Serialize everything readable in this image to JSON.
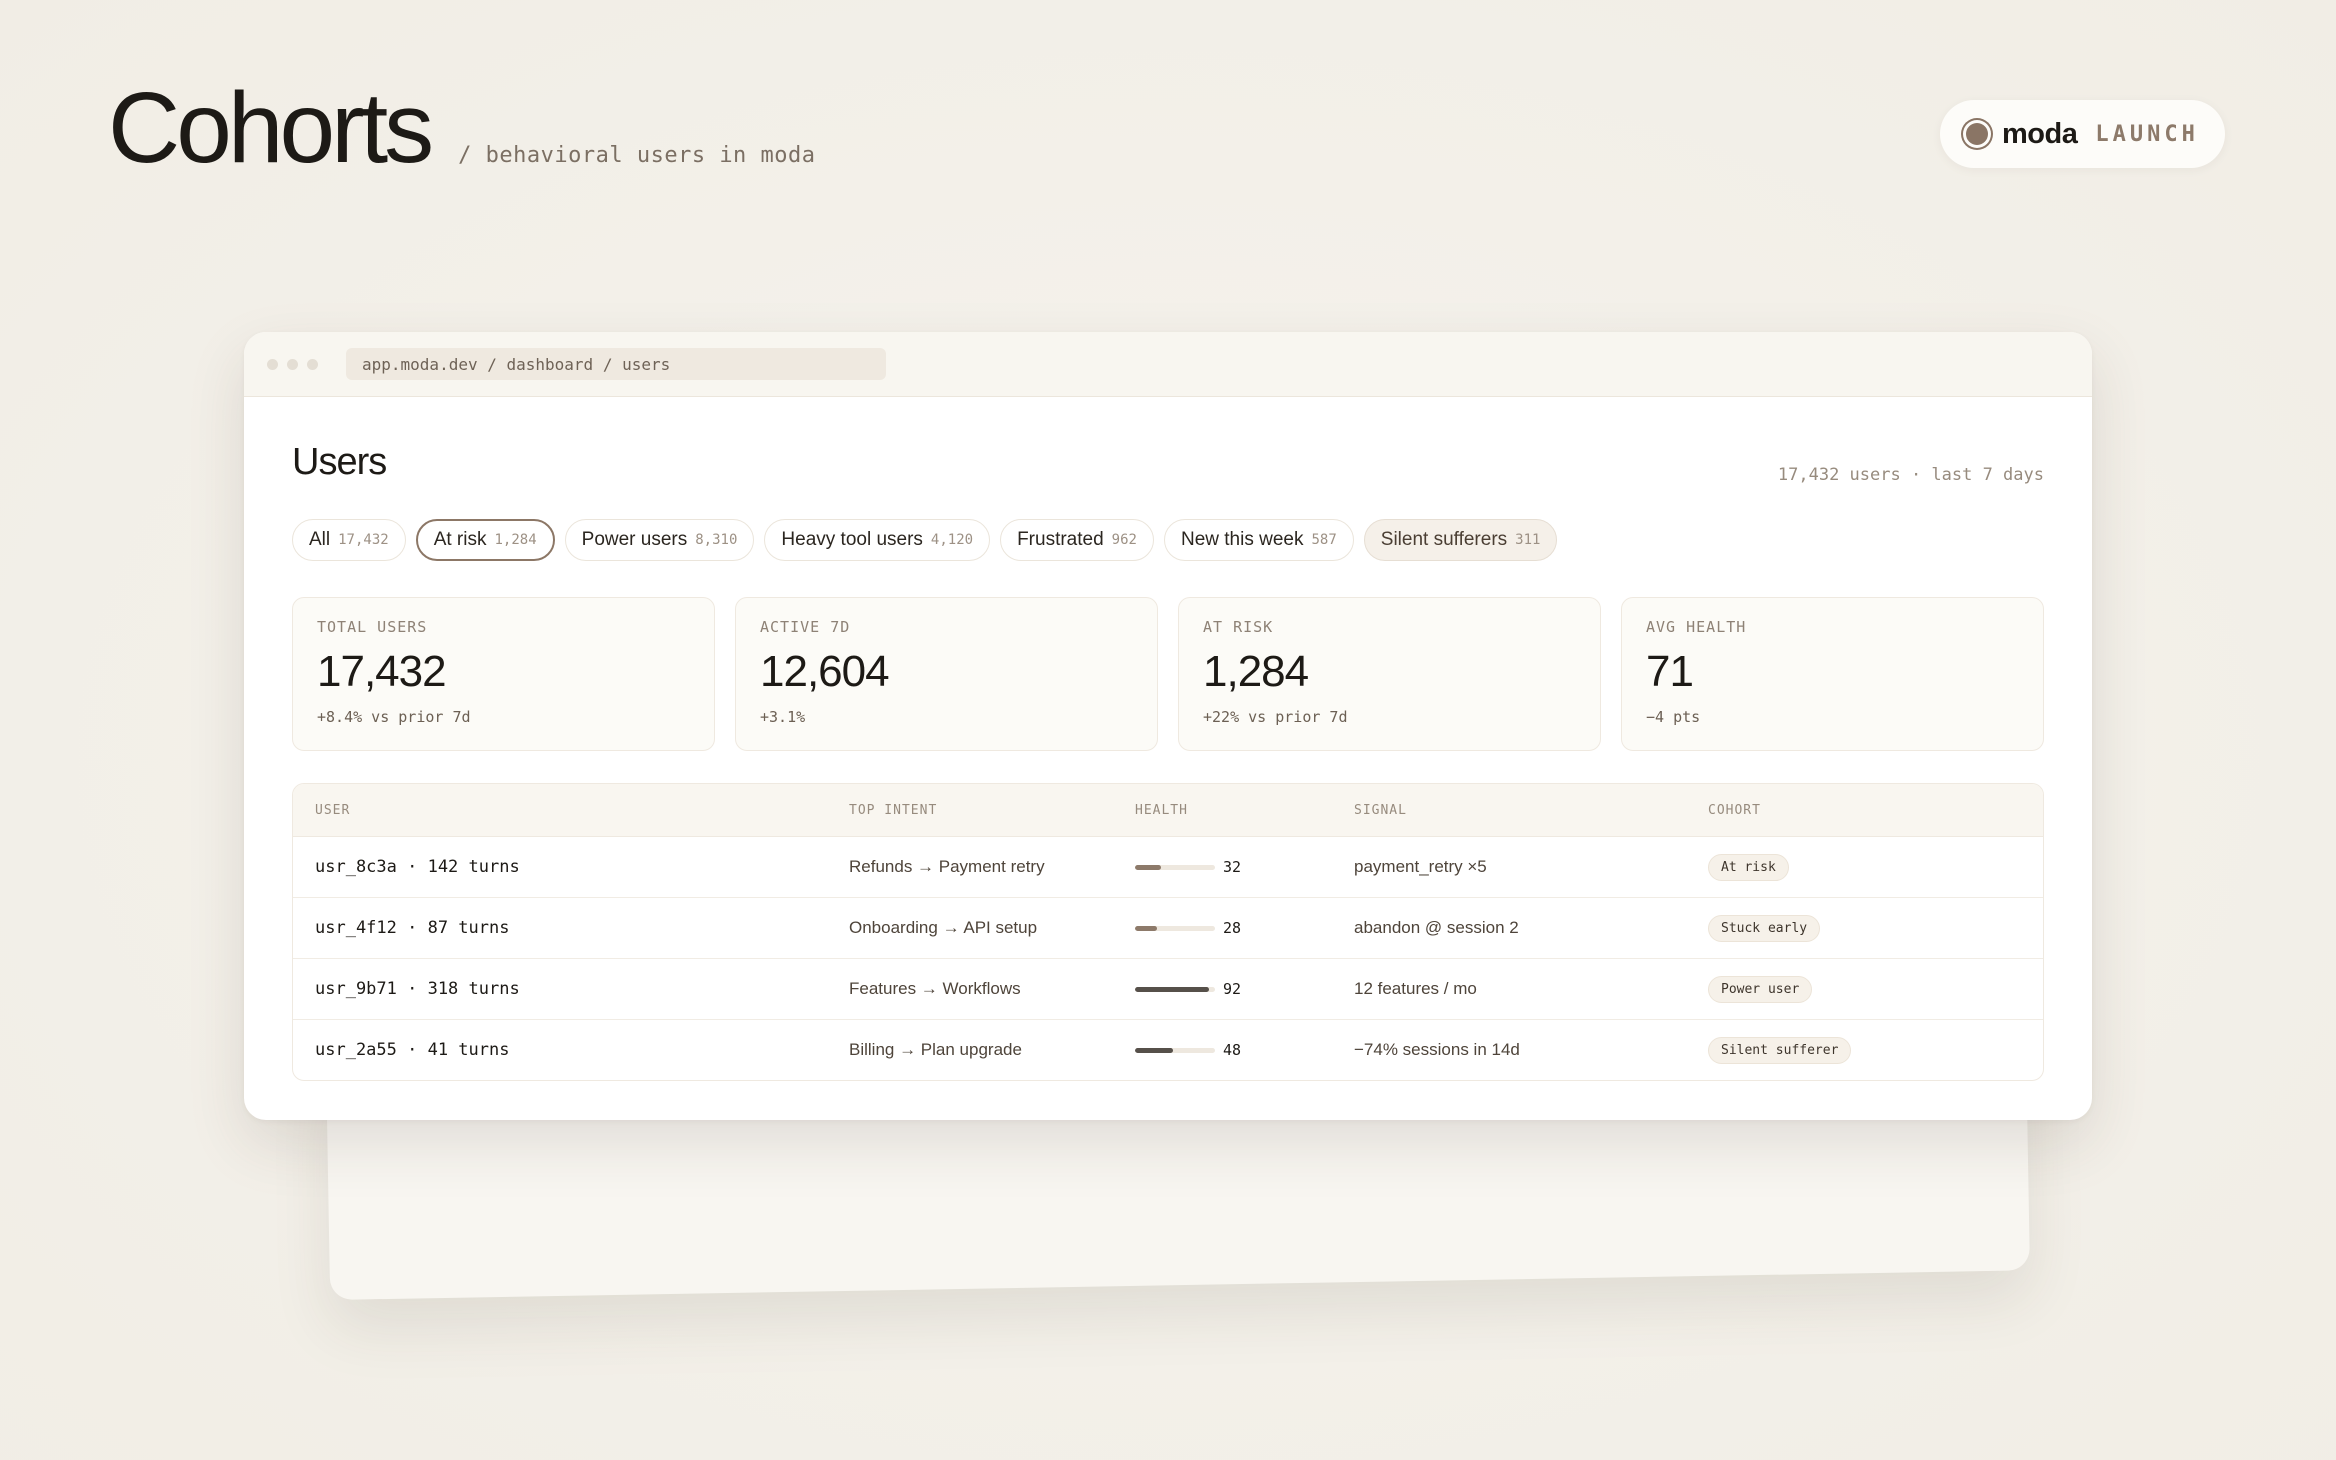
{
  "header": {
    "title": "Cohorts",
    "subtitle": "/ behavioral users in moda"
  },
  "brand": {
    "name": "moda",
    "tag": "LAUNCH",
    "logo_icon": "circle-logo-icon"
  },
  "browser": {
    "url": "app.moda.dev / dashboard / users"
  },
  "page": {
    "title": "Users",
    "meta": "17,432 users · last 7 days"
  },
  "filters": [
    {
      "label": "All",
      "count": "17,432",
      "state": "default"
    },
    {
      "label": "At risk",
      "count": "1,284",
      "state": "active"
    },
    {
      "label": "Power users",
      "count": "8,310",
      "state": "default"
    },
    {
      "label": "Heavy tool users",
      "count": "4,120",
      "state": "default"
    },
    {
      "label": "Frustrated",
      "count": "962",
      "state": "default"
    },
    {
      "label": "New this week",
      "count": "587",
      "state": "default"
    },
    {
      "label": "Silent sufferers",
      "count": "311",
      "state": "tinted"
    }
  ],
  "stats": [
    {
      "label": "TOTAL USERS",
      "value": "17,432",
      "delta": "+8.4% vs prior 7d"
    },
    {
      "label": "ACTIVE 7D",
      "value": "12,604",
      "delta": "+3.1%"
    },
    {
      "label": "AT RISK",
      "value": "1,284",
      "delta": "+22% vs prior 7d"
    },
    {
      "label": "AVG HEALTH",
      "value": "71",
      "delta": "−4 pts"
    }
  ],
  "table": {
    "columns": [
      "USER",
      "TOP INTENT",
      "HEALTH",
      "SIGNAL",
      "COHORT"
    ],
    "rows": [
      {
        "user": "usr_8c3a · 142 turns",
        "intent": "Refunds → Payment retry",
        "health": 32,
        "health_label": "32",
        "bar_color": "#8d7a6a",
        "signal": "payment_retry ×5",
        "cohort": "At risk"
      },
      {
        "user": "usr_4f12 · 87 turns",
        "intent": "Onboarding → API setup",
        "health": 28,
        "health_label": "28",
        "bar_color": "#8d7a6a",
        "signal": "abandon @ session 2",
        "cohort": "Stuck early"
      },
      {
        "user": "usr_9b71 · 318 turns",
        "intent": "Features → Workflows",
        "health": 92,
        "health_label": "92",
        "bar_color": "#56504a",
        "signal": "12 features / mo",
        "cohort": "Power user"
      },
      {
        "user": "usr_2a55 · 41 turns",
        "intent": "Billing → Plan upgrade",
        "health": 48,
        "health_label": "48",
        "bar_color": "#56504a",
        "signal": "−74% sessions in 14d",
        "cohort": "Silent sufferer"
      }
    ]
  }
}
